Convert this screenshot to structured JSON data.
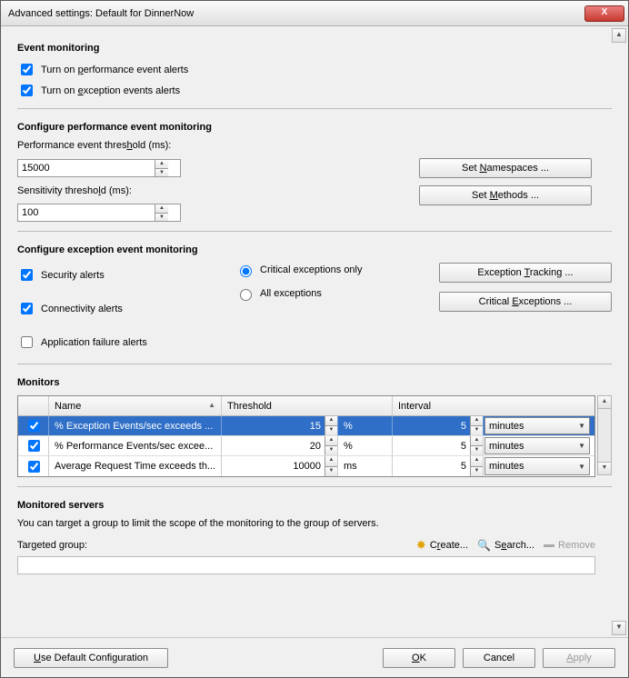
{
  "window": {
    "title": "Advanced settings: Default for DinnerNow"
  },
  "event_monitoring": {
    "heading": "Event monitoring",
    "perf_alerts_pre": "Turn on ",
    "perf_alerts_u": "p",
    "perf_alerts_post": "erformance event alerts",
    "perf_alerts_checked": true,
    "exc_alerts_pre": "Turn on ",
    "exc_alerts_u": "e",
    "exc_alerts_post": "xception events alerts",
    "exc_alerts_checked": true
  },
  "perf_section": {
    "heading": "Configure performance event monitoring",
    "threshold_pre": "Performance event thres",
    "threshold_u": "h",
    "threshold_post": "old (ms):",
    "threshold_value": "15000",
    "sens_pre": "Sensitivity thresho",
    "sens_u": "l",
    "sens_post": "d (ms):",
    "sens_value": "100",
    "set_ns_pre": "Set ",
    "set_ns_u": "N",
    "set_ns_post": "amespaces ...",
    "set_m_pre": "Set ",
    "set_m_u": "M",
    "set_m_post": "ethods ..."
  },
  "exc_section": {
    "heading": "Configure exception event monitoring",
    "security_label": "Security alerts",
    "security_checked": true,
    "connectivity_label": "Connectivity alerts",
    "connectivity_checked": true,
    "appfail_label": "Application failure alerts",
    "appfail_checked": false,
    "critical_only_label": "Critical exceptions only",
    "all_exc_label": "All exceptions",
    "radio_selected": "critical",
    "tracking_pre": "Exception ",
    "tracking_u": "T",
    "tracking_post": "racking ...",
    "critical_btn_pre": "Critical ",
    "critical_btn_u": "E",
    "critical_btn_post": "xceptions ..."
  },
  "monitors": {
    "heading": "Monitors",
    "columns": {
      "name": "Name",
      "threshold": "Threshold",
      "interval": "Interval"
    },
    "rows": [
      {
        "checked": true,
        "name": "% Exception Events/sec exceeds ...",
        "threshold": "15",
        "unit": "%",
        "interval": "5",
        "interval_unit": "minutes",
        "selected": true
      },
      {
        "checked": true,
        "name": "% Performance Events/sec excee...",
        "threshold": "20",
        "unit": "%",
        "interval": "5",
        "interval_unit": "minutes",
        "selected": false
      },
      {
        "checked": true,
        "name": "Average Request Time exceeds th...",
        "threshold": "10000",
        "unit": "ms",
        "interval": "5",
        "interval_unit": "minutes",
        "selected": false
      }
    ]
  },
  "servers": {
    "heading": "Monitored servers",
    "desc": "You can target a group to limit the scope of the monitoring to the group of servers.",
    "targeted_label": "Targeted group:",
    "create_pre": "C",
    "create_u": "r",
    "create_post": "eate...",
    "search_pre": "S",
    "search_u": "e",
    "search_post": "arch...",
    "remove_label": "Remove"
  },
  "footer": {
    "use_default_pre": "",
    "use_default_u": "U",
    "use_default_post": "se Default Configuration",
    "ok_u": "O",
    "ok_post": "K",
    "cancel": "Cancel",
    "apply_u": "A",
    "apply_post": "pply"
  }
}
